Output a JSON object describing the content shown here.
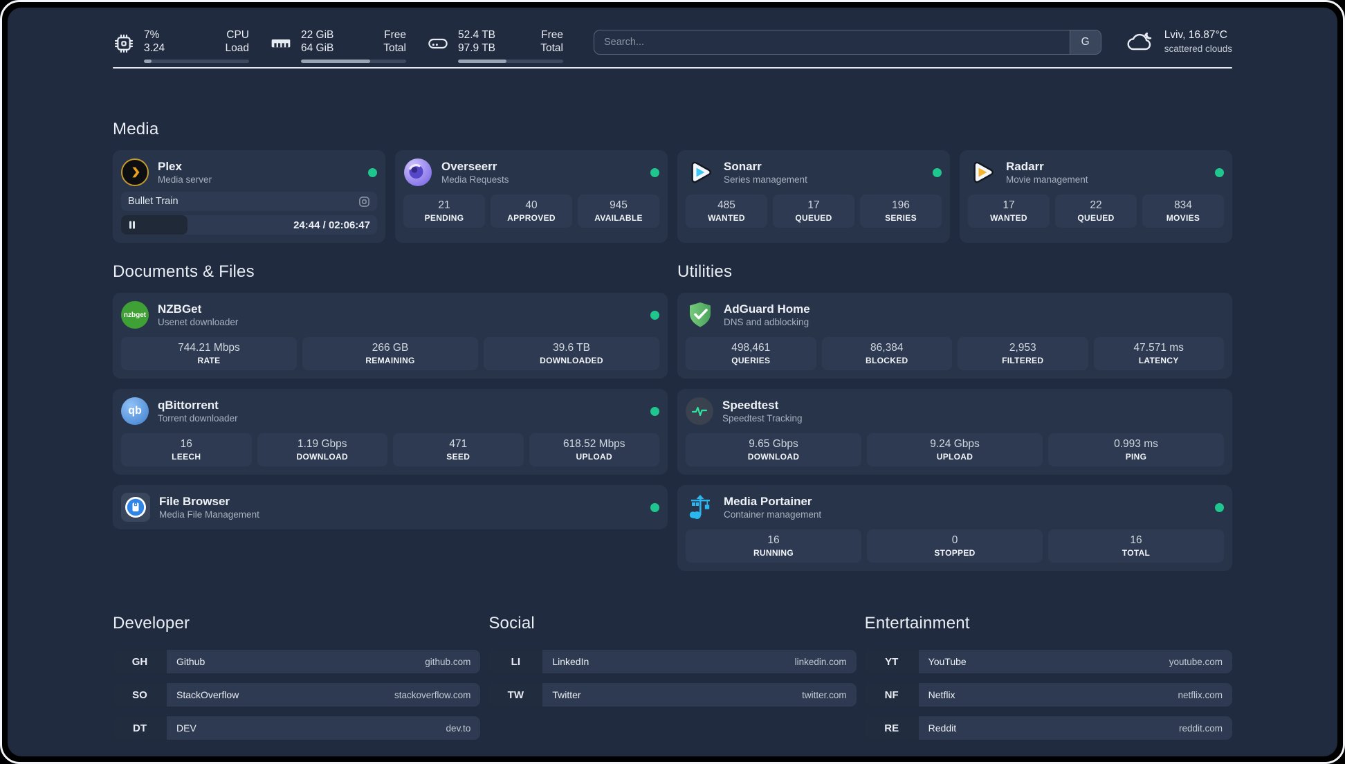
{
  "colors": {
    "panel": "#202b3f",
    "card": "#283449",
    "tile": "#2d3a51",
    "online_dot": "#1fc78e",
    "divider": "#e6eaf0",
    "bar_fill": "#9aa4b5"
  },
  "header": {
    "cpu": {
      "line1_value": "7%",
      "line2_value": "3.24",
      "line1_label": "CPU",
      "line2_label": "Load",
      "percent": 7
    },
    "memory": {
      "line1_value": "22 GiB",
      "line2_value": "64 GiB",
      "line1_label": "Free",
      "line2_label": "Total",
      "percent": 66
    },
    "disk": {
      "line1_value": "52.4 TB",
      "line2_value": "97.9 TB",
      "line1_label": "Free",
      "line2_label": "Total",
      "percent": 46
    }
  },
  "search": {
    "placeholder": "Search...",
    "button": "G"
  },
  "weather": {
    "location_temp": "Lviv, 16.87°C",
    "condition": "scattered clouds"
  },
  "media": {
    "title": "Media",
    "plex": {
      "name": "Plex",
      "desc": "Media server",
      "online": true,
      "now_playing": "Bullet Train",
      "time": "24:44 / 02:06:47",
      "progress_percent": 26
    },
    "overseerr": {
      "name": "Overseerr",
      "desc": "Media Requests",
      "online": true,
      "stats": [
        {
          "value": "21",
          "label": "PENDING"
        },
        {
          "value": "40",
          "label": "APPROVED"
        },
        {
          "value": "945",
          "label": "AVAILABLE"
        }
      ]
    },
    "sonarr": {
      "name": "Sonarr",
      "desc": "Series management",
      "online": true,
      "stats": [
        {
          "value": "485",
          "label": "WANTED"
        },
        {
          "value": "17",
          "label": "QUEUED"
        },
        {
          "value": "196",
          "label": "SERIES"
        }
      ]
    },
    "radarr": {
      "name": "Radarr",
      "desc": "Movie management",
      "online": true,
      "stats": [
        {
          "value": "17",
          "label": "WANTED"
        },
        {
          "value": "22",
          "label": "QUEUED"
        },
        {
          "value": "834",
          "label": "MOVIES"
        }
      ]
    }
  },
  "documents": {
    "title": "Documents & Files",
    "nzbget": {
      "name": "NZBGet",
      "desc": "Usenet downloader",
      "online": true,
      "icon_text": "nzbget",
      "stats": [
        {
          "value": "744.21 Mbps",
          "label": "RATE"
        },
        {
          "value": "266 GB",
          "label": "REMAINING"
        },
        {
          "value": "39.6 TB",
          "label": "DOWNLOADED"
        }
      ]
    },
    "qbittorrent": {
      "name": "qBittorrent",
      "desc": "Torrent downloader",
      "online": true,
      "icon_text": "qb",
      "stats": [
        {
          "value": "16",
          "label": "LEECH"
        },
        {
          "value": "1.19 Gbps",
          "label": "DOWNLOAD"
        },
        {
          "value": "471",
          "label": "SEED"
        },
        {
          "value": "618.52 Mbps",
          "label": "UPLOAD"
        }
      ]
    },
    "filebrowser": {
      "name": "File Browser",
      "desc": "Media File Management",
      "online": true
    }
  },
  "utilities": {
    "title": "Utilities",
    "adguard": {
      "name": "AdGuard Home",
      "desc": "DNS and adblocking",
      "online": false,
      "stats": [
        {
          "value": "498,461",
          "label": "QUERIES"
        },
        {
          "value": "86,384",
          "label": "BLOCKED"
        },
        {
          "value": "2,953",
          "label": "FILTERED"
        },
        {
          "value": "47.571 ms",
          "label": "LATENCY"
        }
      ]
    },
    "speedtest": {
      "name": "Speedtest",
      "desc": "Speedtest Tracking",
      "online": false,
      "stats": [
        {
          "value": "9.65 Gbps",
          "label": "DOWNLOAD"
        },
        {
          "value": "9.24 Gbps",
          "label": "UPLOAD"
        },
        {
          "value": "0.993 ms",
          "label": "PING"
        }
      ]
    },
    "portainer": {
      "name": "Media Portainer",
      "desc": "Container management",
      "online": true,
      "stats": [
        {
          "value": "16",
          "label": "RUNNING"
        },
        {
          "value": "0",
          "label": "STOPPED"
        },
        {
          "value": "16",
          "label": "TOTAL"
        }
      ]
    }
  },
  "bookmarks": {
    "developer": {
      "title": "Developer",
      "items": [
        {
          "abbr": "GH",
          "name": "Github",
          "domain": "github.com"
        },
        {
          "abbr": "SO",
          "name": "StackOverflow",
          "domain": "stackoverflow.com"
        },
        {
          "abbr": "DT",
          "name": "DEV",
          "domain": "dev.to"
        }
      ]
    },
    "social": {
      "title": "Social",
      "items": [
        {
          "abbr": "LI",
          "name": "LinkedIn",
          "domain": "linkedin.com"
        },
        {
          "abbr": "TW",
          "name": "Twitter",
          "domain": "twitter.com"
        }
      ]
    },
    "entertainment": {
      "title": "Entertainment",
      "items": [
        {
          "abbr": "YT",
          "name": "YouTube",
          "domain": "youtube.com"
        },
        {
          "abbr": "NF",
          "name": "Netflix",
          "domain": "netflix.com"
        },
        {
          "abbr": "RE",
          "name": "Reddit",
          "domain": "reddit.com"
        }
      ]
    }
  }
}
